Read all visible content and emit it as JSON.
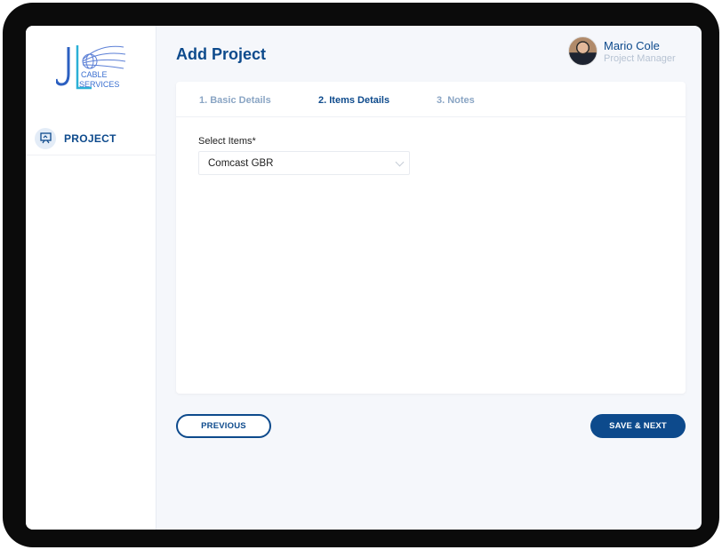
{
  "sidebar": {
    "logo_text": "JL CABLE SERVICES",
    "items": [
      {
        "label": "PROJECT",
        "icon": "presentation-board-icon"
      }
    ]
  },
  "header": {
    "title": "Add Project",
    "user": {
      "name": "Mario Cole",
      "role": "Project Manager"
    }
  },
  "steps": [
    {
      "label": "1. Basic Details"
    },
    {
      "label": "2. Items Details",
      "active": true
    },
    {
      "label": "3. Notes"
    }
  ],
  "form": {
    "select_label": "Select Items*",
    "select_value": "Comcast GBR"
  },
  "buttons": {
    "previous": "PREVIOUS",
    "save_next": "SAVE & NEXT"
  },
  "colors": {
    "primary": "#0d4a8c",
    "background": "#f5f7fb"
  }
}
